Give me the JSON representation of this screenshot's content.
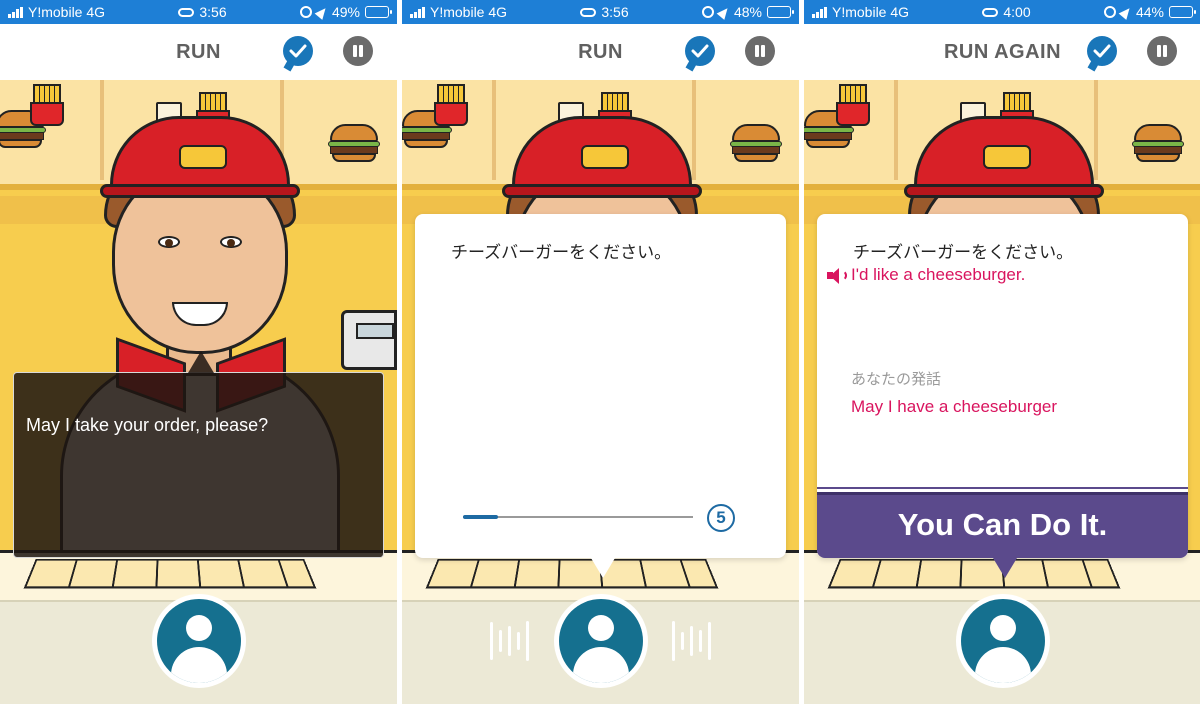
{
  "status": {
    "carrier": "Y!mobile 4G",
    "panels": [
      {
        "time": "3:56",
        "battery": "49%",
        "battery_level": 0.49
      },
      {
        "time": "3:56",
        "battery": "48%",
        "battery_level": 0.48
      },
      {
        "time": "4:00",
        "battery": "44%",
        "battery_level": 0.44
      }
    ]
  },
  "header": {
    "titles": [
      "RUN",
      "RUN",
      "RUN AGAIN"
    ],
    "icons": [
      "check-icon",
      "pause-icon"
    ]
  },
  "screen1": {
    "prompt": "May I take your order, please?"
  },
  "screen2": {
    "japanese": "チーズバーガーをください。",
    "countdown": "5",
    "progress": 0.15
  },
  "screen3": {
    "japanese": "チーズバーガーをください。",
    "english": "I'd like a cheeseburger.",
    "your_label": "あなたの発話",
    "your_speech": "May I have a cheeseburger",
    "feedback": "You Can Do It."
  },
  "colors": {
    "status_bar": "#1e7fd6",
    "accent_blue": "#1976b9",
    "highlight": "#d9145e",
    "feedback_banner": "#5b4a8c",
    "avatar": "#15708f"
  }
}
